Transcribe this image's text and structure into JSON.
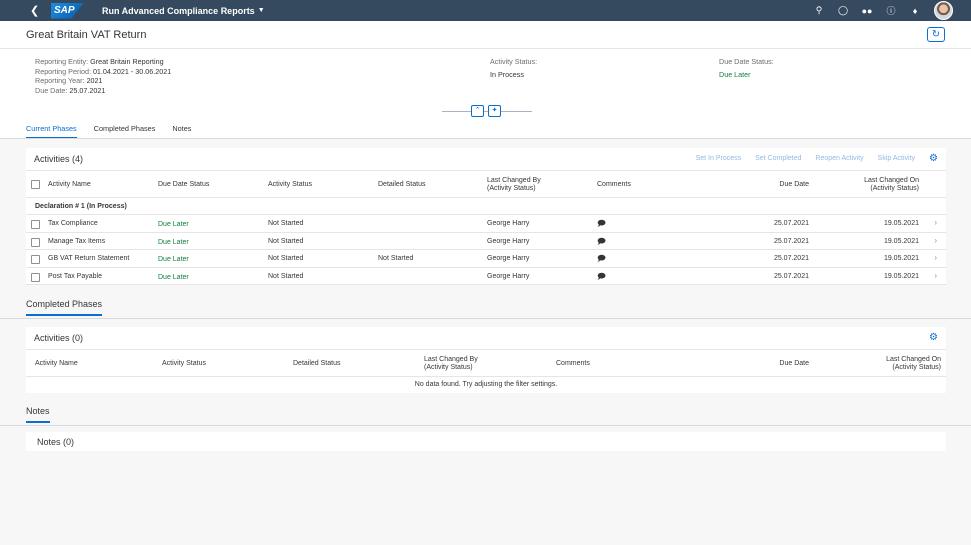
{
  "shell": {
    "logo": "SAP",
    "app_title": "Run Advanced Compliance Reports",
    "icons": [
      "search-icon",
      "help-circle-icon",
      "binoculars-icon",
      "question-icon",
      "bell-icon"
    ]
  },
  "page": {
    "title": "Great Britain VAT Return",
    "facets": {
      "entity_label": "Reporting Entity:",
      "entity_value": "Great Britain Reporting",
      "period_label": "Reporting Period:",
      "period_value": "01.04.2021 - 30.06.2021",
      "year_label": "Reporting Year:",
      "year_value": "2021",
      "due_label": "Due Date:",
      "due_value": "25.07.2021",
      "activity_status_label": "Activity Status:",
      "activity_status_value": "In Process",
      "due_status_label": "Due Date Status:",
      "due_status_value": "Due Later"
    },
    "tabs": [
      "Current Phases",
      "Completed Phases",
      "Notes"
    ]
  },
  "activities": {
    "title": "Activities (4)",
    "toolbar": [
      "Set In Process",
      "Set Completed",
      "Reopen Activity",
      "Skip Activity"
    ],
    "columns": {
      "name": "Activity Name",
      "due_status": "Due Date Status",
      "status": "Activity Status",
      "detailed": "Detailed Status",
      "changed_by_1": "Last Changed By",
      "changed_by_2": "(Activity Status)",
      "comments": "Comments",
      "due_date": "Due Date",
      "changed_on_1": "Last Changed On",
      "changed_on_2": "(Activity Status)"
    },
    "group": "Declaration # 1 (In Process)",
    "rows": [
      {
        "name": "Tax Compliance",
        "due_status": "Due Later",
        "status": "Not Started",
        "detailed": "",
        "changed_by": "George Harry",
        "due_date": "25.07.2021",
        "changed_on": "19.05.2021"
      },
      {
        "name": "Manage Tax Items",
        "due_status": "Due Later",
        "status": "Not Started",
        "detailed": "",
        "changed_by": "George Harry",
        "due_date": "25.07.2021",
        "changed_on": "19.05.2021"
      },
      {
        "name": "GB VAT Return Statement",
        "due_status": "Due Later",
        "status": "Not Started",
        "detailed": "Not Started",
        "changed_by": "George Harry",
        "due_date": "25.07.2021",
        "changed_on": "19.05.2021"
      },
      {
        "name": "Post Tax Payable",
        "due_status": "Due Later",
        "status": "Not Started",
        "detailed": "",
        "changed_by": "George Harry",
        "due_date": "25.07.2021",
        "changed_on": "19.05.2021"
      }
    ]
  },
  "completed": {
    "section_title": "Completed Phases",
    "card_title": "Activities (0)",
    "columns": {
      "name": "Activity Name",
      "status": "Activity Status",
      "detailed": "Detailed Status",
      "changed_by_1": "Last Changed By",
      "changed_by_2": "(Activity Status)",
      "comments": "Comments",
      "due_date": "Due Date",
      "changed_on_1": "Last Changed On",
      "changed_on_2": "(Activity Status)"
    },
    "no_data": "No data found. Try adjusting the filter settings."
  },
  "notes": {
    "section_title": "Notes",
    "card_title": "Notes (0)"
  }
}
